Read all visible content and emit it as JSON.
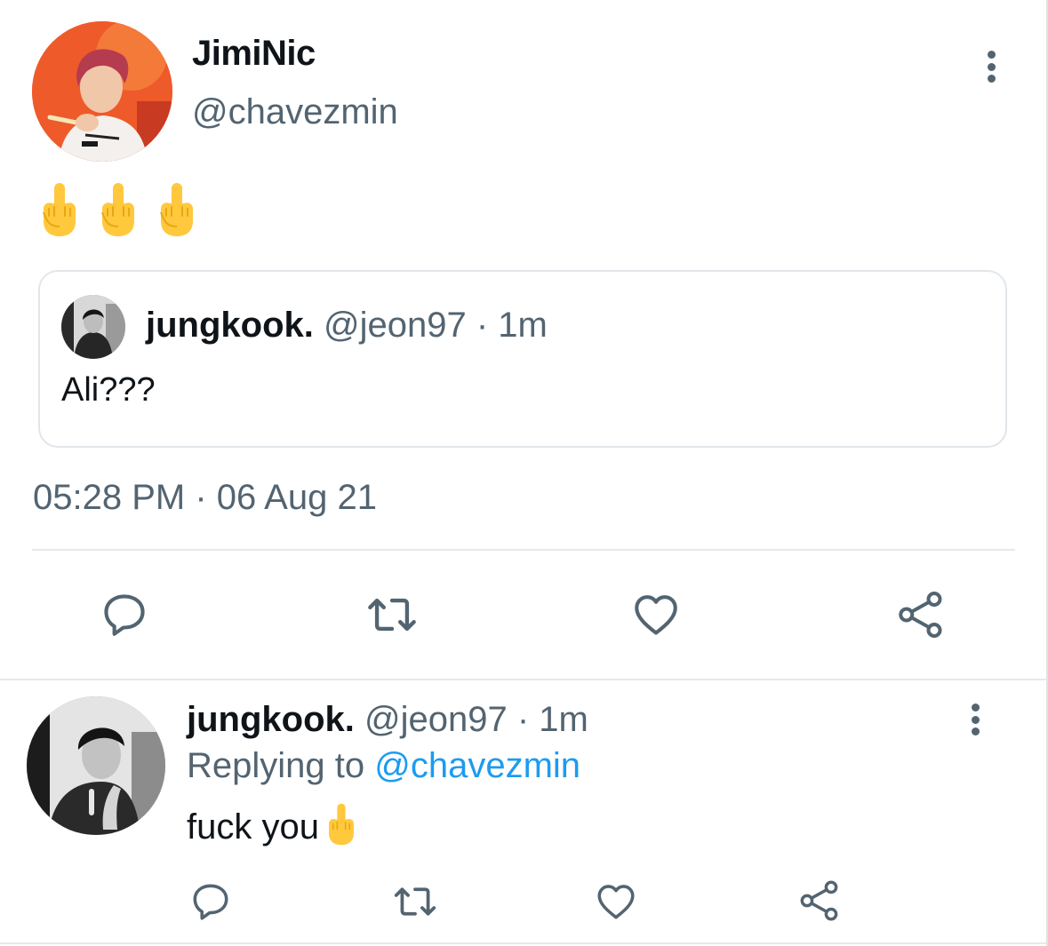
{
  "main_tweet": {
    "author_name": "JimiNic",
    "author_handle": "@chavezmin",
    "body_emojis": [
      "middle-finger-emoji",
      "middle-finger-emoji",
      "middle-finger-emoji"
    ],
    "timestamp": "05:28 PM · 06 Aug 21"
  },
  "quoted_tweet": {
    "author_name": "jungkook.",
    "author_meta": "@jeon97 · 1m",
    "text": "Ali???"
  },
  "reply": {
    "author_name": "jungkook.",
    "author_meta": "@jeon97 · 1m",
    "replying_prefix": "Replying to",
    "replying_handle": "@chavezmin",
    "text": "fuck you"
  },
  "icons": {
    "actions": [
      "reply-icon",
      "retweet-icon",
      "like-icon",
      "share-icon"
    ],
    "more": "more-options-icon"
  },
  "colors": {
    "text_primary": "#0f1419",
    "text_secondary": "#536471",
    "link": "#1d9bf0",
    "border": "#e1e6ea",
    "emoji_yellow": "#ffc83d",
    "avatar_orange": "#ef5a2a"
  }
}
